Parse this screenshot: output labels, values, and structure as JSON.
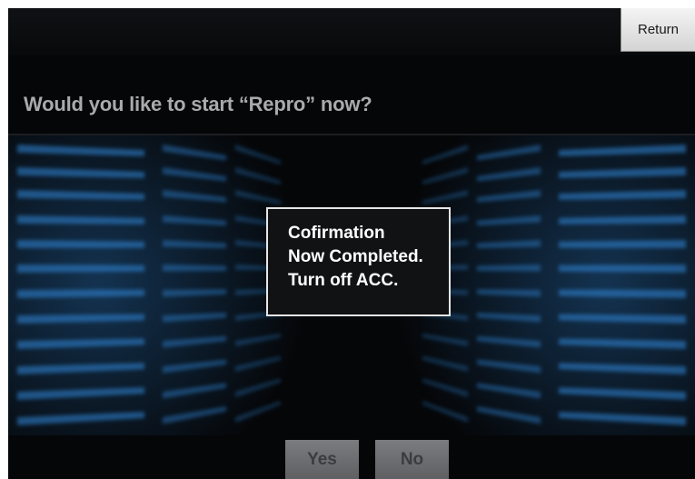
{
  "header": {
    "return_label": "Return"
  },
  "prompt": {
    "question": "Would you like to start “Repro” now?"
  },
  "dialog": {
    "lines": [
      "Cofirmation",
      "Now Completed.",
      "Turn off ACC."
    ]
  },
  "actions": {
    "yes_label": "Yes",
    "no_label": "No"
  },
  "colors": {
    "background": "#050608",
    "glow": "#2f86d8",
    "dialog_border": "#e6e6e6",
    "disabled_button": "#6c6d70"
  }
}
